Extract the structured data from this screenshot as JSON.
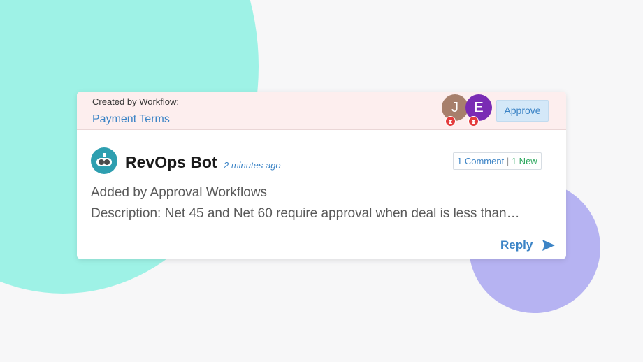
{
  "header": {
    "created_by": "Created by Workflow:",
    "workflow_name": "Payment Terms",
    "approvers": [
      {
        "initial": "J",
        "color": "#a77f6c",
        "status": "pending"
      },
      {
        "initial": "E",
        "color": "#7a2bb4",
        "status": "pending"
      }
    ],
    "approve_label": "Approve"
  },
  "post": {
    "author": "RevOps Bot",
    "time": "2 minutes ago",
    "comments": "1 Comment",
    "separator": "|",
    "new": "1 New",
    "line1": "Added by Approval Workflows",
    "line2": "Description: Net 45 and Net 60 require approval when deal is less than…",
    "reply_label": "Reply"
  },
  "colors": {
    "accent": "#3c84c6",
    "new_green": "#27a55a",
    "pending_red": "#e43d3d",
    "header_bg": "#fdeeee",
    "teal_blob": "#9ef2e6",
    "purple_blob": "#b6b3f2"
  },
  "icons": {
    "bot": "robot-icon",
    "pending": "hourglass-icon",
    "reply": "send-icon"
  }
}
